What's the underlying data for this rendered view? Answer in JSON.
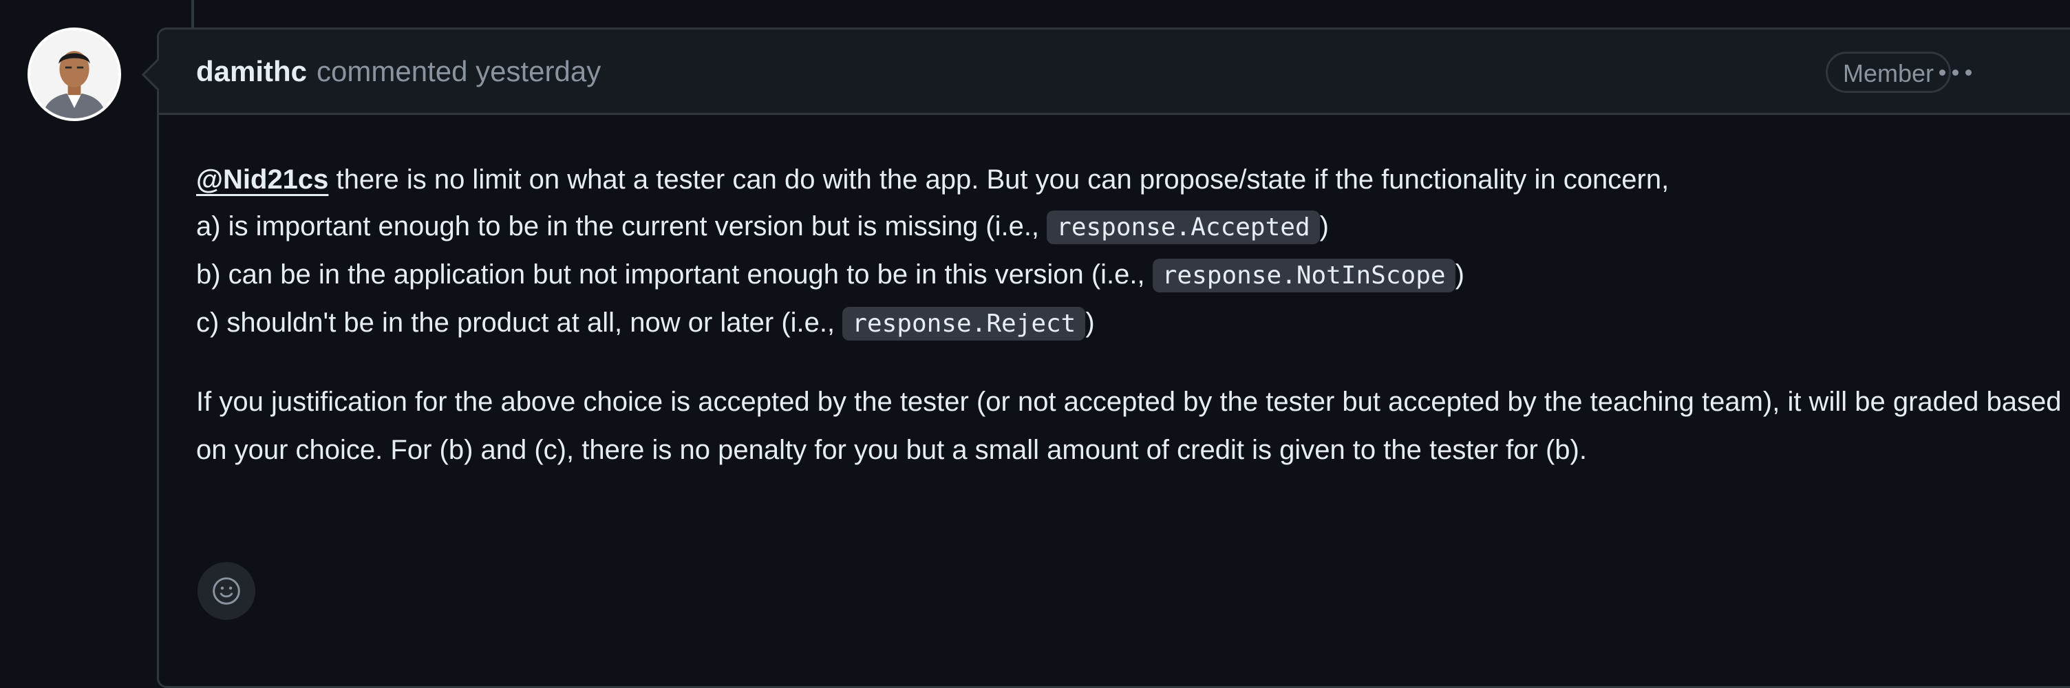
{
  "comment": {
    "author": "damithc",
    "action": "commented yesterday",
    "badge": "Member",
    "body": {
      "mention": "@Nid21cs",
      "line1_rest": " there is no limit on what a tester can do with the app. But you can propose/state if the functionality in concern,",
      "line2_prefix": "a) is important enough to be in the current version but is missing (i.e., ",
      "line2_code": "response.Accepted",
      "line2_suffix": ")",
      "line3_prefix": "b) can be in the application but not important enough to be in this version (i.e., ",
      "line3_code": "response.NotInScope",
      "line3_suffix": ")",
      "line4_prefix": "c) shouldn't be in the product at all, now or later (i.e., ",
      "line4_code": "response.Reject",
      "line4_suffix": ")",
      "para2": "If you justification for the above choice is accepted by the tester (or not accepted by the tester but accepted by the teaching team), it will be graded based on your choice. For (b) and (c), there is no penalty for you but a small amount of credit is given to the tester for (b)."
    },
    "icons": {
      "menu": "kebab-horizontal-icon",
      "reaction": "smiley-icon"
    }
  },
  "colors": {
    "background": "#0d1117",
    "header_background": "#161b22",
    "border": "#30363d",
    "text": "#e6edf3",
    "muted": "#8b949e",
    "code_background": "#343941"
  }
}
